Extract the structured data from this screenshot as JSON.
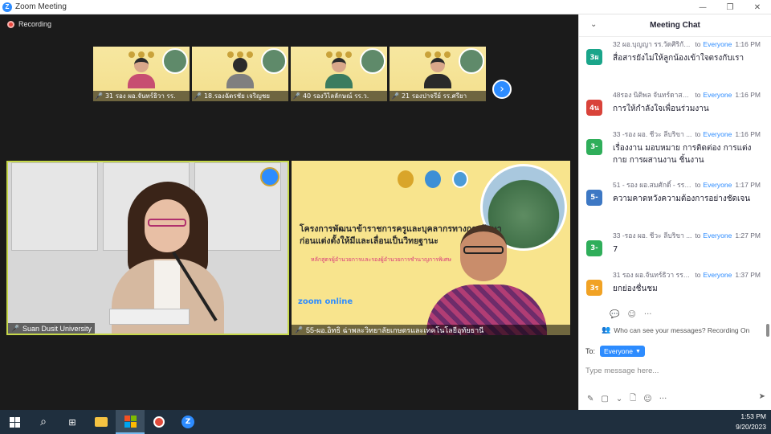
{
  "window": {
    "title": "Zoom Meeting",
    "controls": [
      "—",
      "❐",
      "✕"
    ]
  },
  "meeting": {
    "recording_label": "Recording",
    "thumbnails": [
      {
        "name": "31 รอง ผอ.จันทร์ธิวา รร."
      },
      {
        "name": "18.รองฉัตรชัย เจริญชย"
      },
      {
        "name": "40 รองวิไลลักษณ์ รร.ว."
      },
      {
        "name": "21 รองปาจรีย์ รร.ศรียา"
      }
    ],
    "next_label": "›",
    "left_tile_name": "Suan Dusit University",
    "right_tile": {
      "banner_line1": "โครงการพัฒนาข้าราชการครูและบุคลากรทางการศึกษา",
      "banner_line2": "ก่อนแต่งตั้งให้มีและเลื่อนเป็นวิทยฐานะ",
      "subtitle": "หลักสูตรผู้อำนวยการและรองผู้อำนวยการชำนาญการพิเศษ",
      "zoom_logo": "zoom online",
      "name": "55-ผอ.อิทธิ ฉ่าพละวิทยาลัยเกษตรและเทคโนโลยีอุทัยธานี"
    }
  },
  "chat": {
    "title": "Meeting Chat",
    "messages": [
      {
        "sender": "32 ผอ.บุญญา รร.วัดศิริกัน...",
        "to": "to",
        "recipient": "Everyone",
        "time": "1:16 PM",
        "avatar": "3ผ",
        "avatar_color": "#1aa58a",
        "text": "สื่อสารยังไม่ให้ลูกน้องเข้าใจตรงกับเรา"
      },
      {
        "sender": "48รอง นิติพล จันทร์ดาสา...",
        "to": "to",
        "recipient": "Everyone",
        "time": "1:16 PM",
        "avatar": "4น",
        "avatar_color": "#d9433a",
        "text": "การให้กำลังใจเพื่อนร่วมงาน"
      },
      {
        "sender": "33 -รอง ผอ. ชีวะ ลีบริขา ...",
        "to": "to",
        "recipient": "Everyone",
        "time": "1:16 PM",
        "avatar": "3-",
        "avatar_color": "#2fae5a",
        "text": "เรื่องงาน มอบหมาย การติดต่อง การแต่งกาย การผสานงาน ชิ้นงาน"
      },
      {
        "sender": "51 - รอง ผอ.สมศักดิ์ - รร....",
        "to": "to",
        "recipient": "Everyone",
        "time": "1:17 PM",
        "avatar": "5-",
        "avatar_color": "#3d78c4",
        "text": "ความคาดหวังความต้องการอย่างชัดเจน"
      },
      {
        "sender": "33 -รอง ผอ. ชีวะ ลีบริขา ...",
        "to": "to",
        "recipient": "Everyone",
        "time": "1:27 PM",
        "avatar": "3-",
        "avatar_color": "#2fae5a",
        "text": "7"
      },
      {
        "sender": "31 รอง ผอ.จันทร์ธิวา รร.อ...",
        "to": "to",
        "recipient": "Everyone",
        "time": "1:37 PM",
        "avatar": "3ร",
        "avatar_color": "#f1a224",
        "text": "ยกย่องชื่นชม"
      }
    ],
    "privacy_text": "Who can see your messages? Recording On",
    "to_label": "To:",
    "recipient_selected": "Everyone",
    "input_placeholder": "Type message here..."
  },
  "taskbar": {
    "time": "1:53 PM",
    "date": "9/20/2023"
  }
}
